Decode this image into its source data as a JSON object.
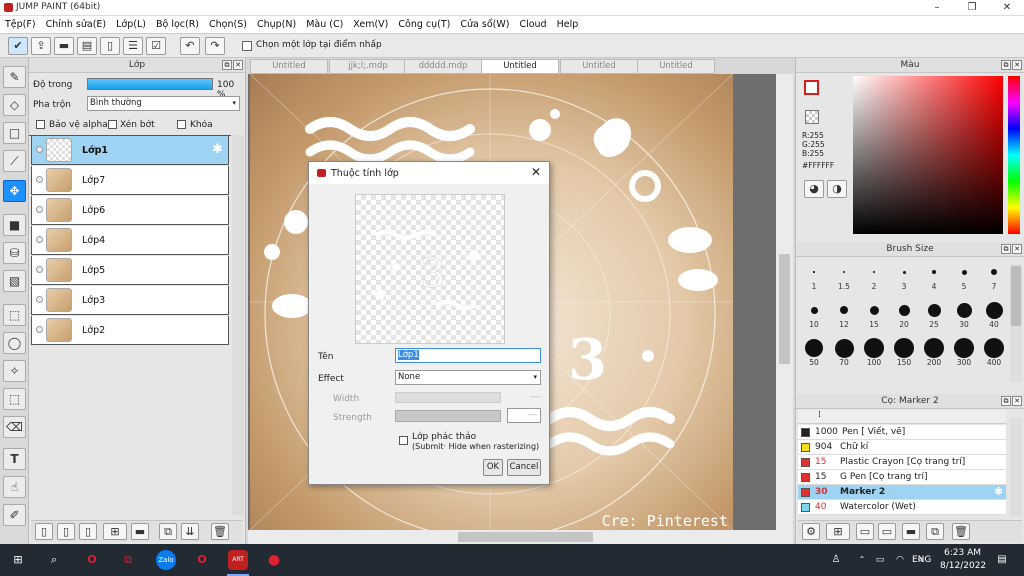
{
  "app": {
    "title": "JUMP PAINT (64bit)"
  },
  "menu": [
    "Tệp(F)",
    "Chỉnh sửa(E)",
    "Lớp(L)",
    "Bộ lọc(R)",
    "Chọn(S)",
    "Chụp(N)",
    "Màu (C)",
    "Xem(V)",
    "Công cụ(T)",
    "Cửa sổ(W)",
    "Cloud",
    "Help"
  ],
  "toolbar": {
    "checkbox_label": "Chọn một lớp tại điểm nhấp"
  },
  "layer_panel": {
    "title": "Lớp",
    "opacity_label": "Độ trong",
    "opacity_value": "100 %",
    "opacity_fraction": 1.0,
    "blend_label": "Pha trộn",
    "blend_value": "Bình thường",
    "protect_alpha": "Bảo vệ alpha",
    "clip": "Xén bớt",
    "lock": "Khóa",
    "layers": [
      {
        "name": "Lớp1",
        "selected": true
      },
      {
        "name": "Lớp7"
      },
      {
        "name": "Lớp6"
      },
      {
        "name": "Lớp4"
      },
      {
        "name": "Lớp5"
      },
      {
        "name": "Lớp3"
      },
      {
        "name": "Lớp2"
      }
    ]
  },
  "tabs": [
    "Untitled",
    "jjk;l;.mdp",
    "ddddd.mdp",
    "Untitled",
    "Untitled",
    "Untitled"
  ],
  "canvas": {
    "watermark": "Cre: Pinterest"
  },
  "color_panel": {
    "title": "Màu",
    "r": "R:255",
    "g": "G:255",
    "b": "B:255",
    "hex": "#FFFFFF"
  },
  "brush_size": {
    "title": "Brush Size",
    "sizes": [
      "1",
      "1.5",
      "2",
      "3",
      "4",
      "5",
      "7",
      "10",
      "12",
      "15",
      "20",
      "25",
      "30",
      "40",
      "50",
      "70",
      "100",
      "150",
      "200",
      "300",
      "400"
    ]
  },
  "brush_list": {
    "title": "Cọ: Marker 2",
    "items": [
      {
        "num": "1000",
        "name": "Pen [ Viết, vẽ]",
        "color": "#222222"
      },
      {
        "num": "904",
        "name": "Chữ kí",
        "color": "#f2e01e"
      },
      {
        "num": "15",
        "name": "Plastic Crayon [Cọ trang trí]",
        "color": "#e03030"
      },
      {
        "num": "15",
        "name": "G Pen [Cọ trang trí]",
        "color": "#e03030"
      },
      {
        "num": "30",
        "name": "Marker 2",
        "color": "#e03030",
        "selected": true
      },
      {
        "num": "40",
        "name": "Watercolor (Wet)",
        "color": "#7fd4f0"
      }
    ]
  },
  "dialog": {
    "title": "Thuộc tính lớp",
    "name_label": "Tên",
    "name_value": "Lớp1",
    "effect_label": "Effect",
    "effect_value": "None",
    "width_label": "Width",
    "strength_label": "Strength",
    "draft_label": "Lớp phác thảo",
    "draft_sub": "(Submit· Hide when rasterizing)",
    "ok": "OK",
    "cancel": "Cancel"
  },
  "taskbar": {
    "lang": "ENG",
    "time": "6:23 AM",
    "date": "8/12/2022"
  }
}
